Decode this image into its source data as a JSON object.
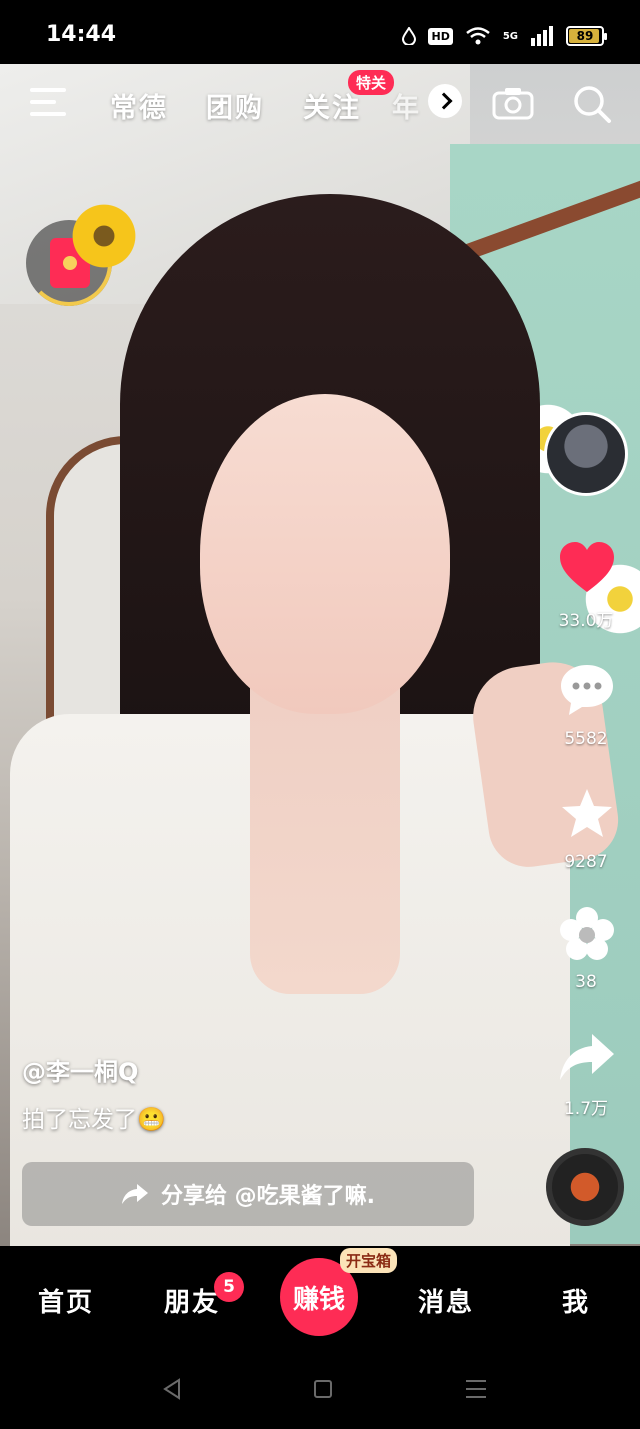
{
  "status_bar": {
    "time": "14:44",
    "hd_badge": "HD",
    "signal_label": "5G",
    "battery": "89"
  },
  "top_nav": {
    "tabs": [
      "常德",
      "团购",
      "关注",
      "年"
    ],
    "follow_badge": "特关",
    "icons": [
      "menu-icon",
      "chevron-right-icon",
      "camera-icon",
      "search-icon"
    ]
  },
  "video": {
    "author": "@李一桐Q",
    "caption": "拍了忘发了😬",
    "share_prompt": "分享给 @吃果酱了嘛."
  },
  "actions": {
    "likes": "33.0万",
    "comments": "5582",
    "favorites": "9287",
    "flowers": "38",
    "shares": "1.7万"
  },
  "bottom_nav": {
    "home": "首页",
    "friends": "朋友",
    "friends_badge": "5",
    "earn": "赚钱",
    "earn_tag": "开宝箱",
    "messages": "消息",
    "me": "我"
  },
  "colors": {
    "accent": "#fe2c55",
    "gold": "#f2c94c"
  }
}
